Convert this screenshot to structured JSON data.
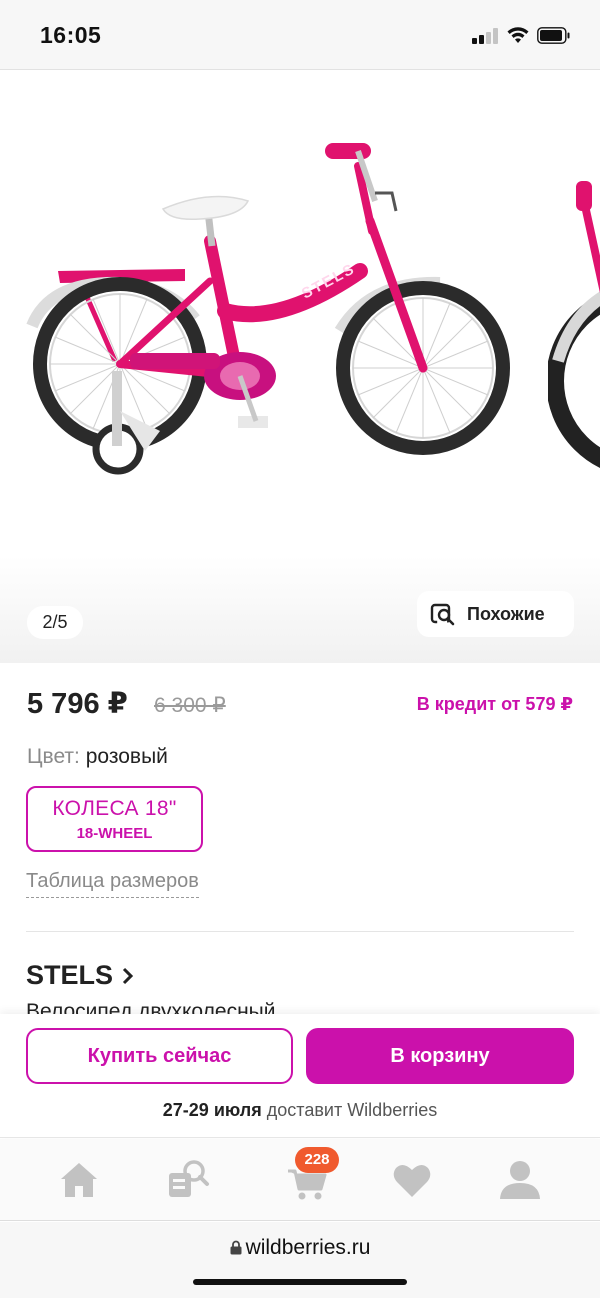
{
  "status_bar": {
    "time": "16:05"
  },
  "gallery": {
    "counter": "2/5",
    "similar_label": "Похожие",
    "bike_frame_color": "#e0126e",
    "bike_text": "STELS"
  },
  "product": {
    "price": "5 796 ₽",
    "old_price": "6 300 ₽",
    "credit": "В кредит от  579 ₽",
    "color_label": "Цвет:",
    "color_value": "розовый",
    "size_main": "КОЛЕСА 18\"",
    "size_sub": "18-WHEEL",
    "size_table": "Таблица размеров",
    "brand": "STELS",
    "description": "Велосипед двухколесный"
  },
  "actions": {
    "buy_now": "Купить сейчас",
    "to_cart": "В корзину",
    "delivery_date": "27-29 июля",
    "delivery_text": "доставит Wildberries"
  },
  "tabbar": {
    "cart_count": "228",
    "icons": [
      "home-icon",
      "catalog-search-icon",
      "cart-icon",
      "heart-icon",
      "profile-icon"
    ]
  },
  "browser": {
    "url": "wildberries.ru"
  },
  "colors": {
    "accent": "#cb11ab",
    "badge": "#f05a2e",
    "icon_gray": "#c2c2c2"
  }
}
